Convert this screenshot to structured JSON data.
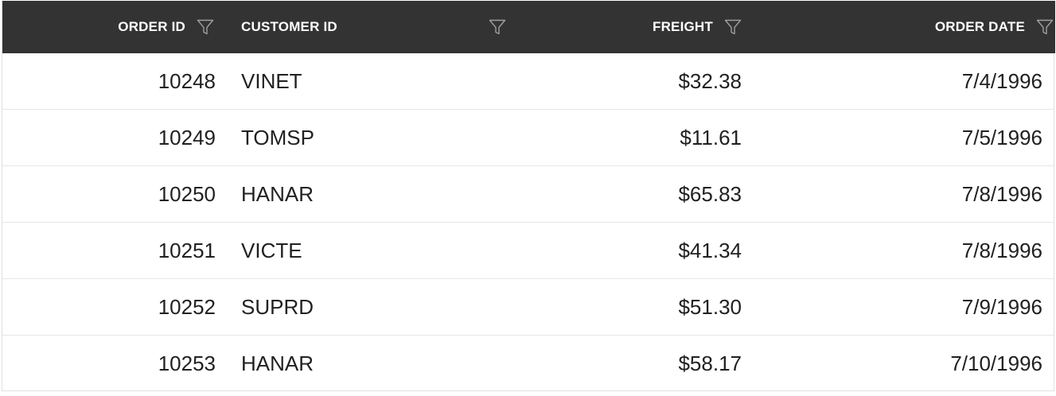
{
  "columns": {
    "order_id": "ORDER ID",
    "customer_id": "CUSTOMER ID",
    "freight": "FREIGHT",
    "order_date": "ORDER DATE"
  },
  "icons": {
    "filter": "filter-funnel-icon"
  },
  "colors": {
    "header_bg": "#333333",
    "header_text": "#ffffff",
    "row_text": "#212121",
    "row_border": "#e6e6e6"
  },
  "rows": [
    {
      "order_id": "10248",
      "customer_id": "VINET",
      "freight": "$32.38",
      "order_date": "7/4/1996"
    },
    {
      "order_id": "10249",
      "customer_id": "TOMSP",
      "freight": "$11.61",
      "order_date": "7/5/1996"
    },
    {
      "order_id": "10250",
      "customer_id": "HANAR",
      "freight": "$65.83",
      "order_date": "7/8/1996"
    },
    {
      "order_id": "10251",
      "customer_id": "VICTE",
      "freight": "$41.34",
      "order_date": "7/8/1996"
    },
    {
      "order_id": "10252",
      "customer_id": "SUPRD",
      "freight": "$51.30",
      "order_date": "7/9/1996"
    },
    {
      "order_id": "10253",
      "customer_id": "HANAR",
      "freight": "$58.17",
      "order_date": "7/10/1996"
    }
  ]
}
